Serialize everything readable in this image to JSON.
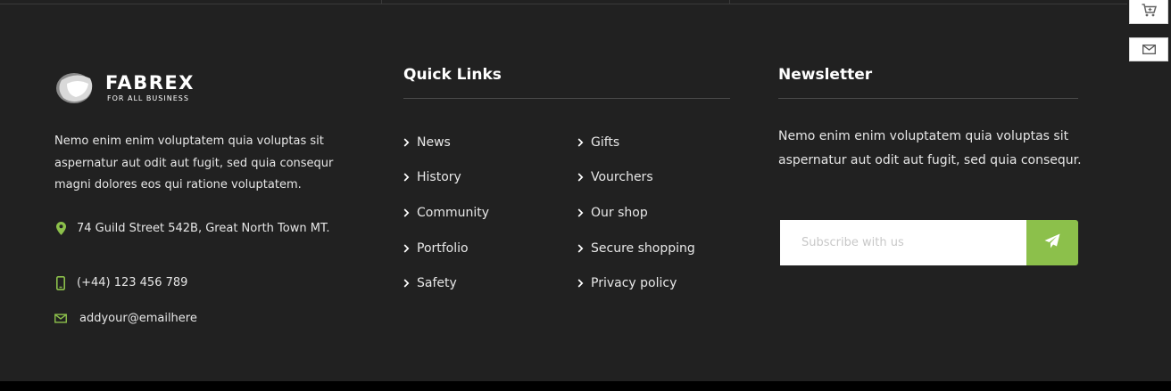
{
  "brand": {
    "name": "FABREX",
    "tagline": "FOR ALL BUSINESS",
    "about": "Nemo enim enim voluptatem quia voluptas sit aspernatur aut odit aut fugit, sed quia consequr magni dolores eos qui ratione voluptatem."
  },
  "contact": {
    "address": "74 Guild Street 542B, Great North Town MT.",
    "phone": "(+44) 123 456 789",
    "email": "addyour@emailhere"
  },
  "quick_links": {
    "title": "Quick Links",
    "col1": [
      "News",
      "History",
      "Community",
      "Portfolio",
      "Safety"
    ],
    "col2": [
      "Gifts",
      "Vourchers",
      "Our shop",
      "Secure shopping",
      "Privacy policy"
    ]
  },
  "newsletter": {
    "title": "Newsletter",
    "text": "Nemo enim enim voluptatem quia voluptas sit aspernatur aut odit aut fugit, sed quia consequr.",
    "placeholder": "Subscribe with us"
  },
  "colors": {
    "accent": "#8cc04b",
    "background": "#212121"
  },
  "icons": {
    "address": "map-pin-icon",
    "phone": "mobile-phone-icon",
    "email": "envelope-icon",
    "send": "paper-plane-icon",
    "side_top": "cart-icon",
    "side_bottom": "envelope-icon"
  }
}
